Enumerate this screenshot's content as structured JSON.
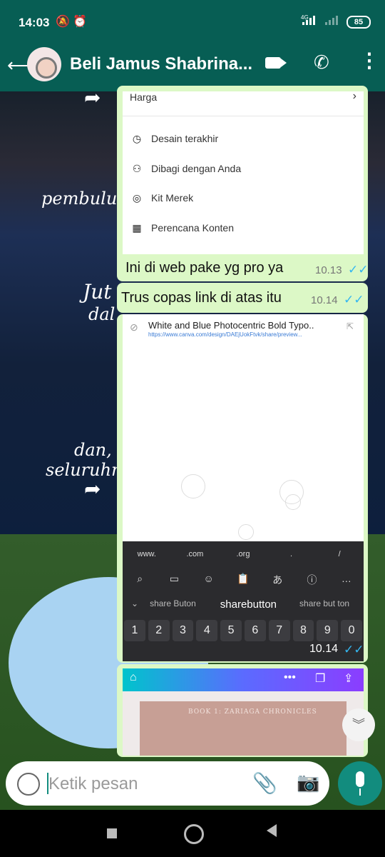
{
  "status": {
    "time": "14:03",
    "network": "4G",
    "battery": "85"
  },
  "header": {
    "contact_name": "Beli Jamus Shabrina..."
  },
  "wallpaper": {
    "texts": [
      "pembuluh",
      "Jut",
      "dal",
      "dan,",
      "seluruhn"
    ]
  },
  "canva_menu": {
    "items": [
      {
        "label": "Harga",
        "icon": "chevron-right-icon"
      },
      {
        "label": "Desain terakhir",
        "icon": "clock-icon"
      },
      {
        "label": "Dibagi dengan Anda",
        "icon": "people-icon"
      },
      {
        "label": "Kit Merek",
        "icon": "brand-kit-icon"
      },
      {
        "label": "Perencana Konten",
        "icon": "calendar-icon"
      }
    ]
  },
  "messages": [
    {
      "text": "Ini di web pake yg pro ya",
      "time": "10.13"
    },
    {
      "text": "Trus  copas link di atas itu",
      "time": "10.14"
    },
    {
      "time": "10.14"
    }
  ],
  "link_preview": {
    "title": "White and Blue Photocentric Bold Typo..",
    "url": "https://www.canva.com/design/DAEjUokFtvk/share/preview..."
  },
  "keyboard": {
    "domains": [
      "www.",
      ".com",
      ".org",
      ".",
      "/"
    ],
    "suggestions": [
      "share Buton",
      "sharebutton",
      "share but ton"
    ],
    "numbers": [
      "1",
      "2",
      "3",
      "4",
      "5",
      "6",
      "7",
      "8",
      "9",
      "0"
    ]
  },
  "canva_preview": {
    "book_text": "BOOK 1: ZARIAGA CHRONICLES"
  },
  "composer": {
    "placeholder": "Ketik pesan"
  }
}
